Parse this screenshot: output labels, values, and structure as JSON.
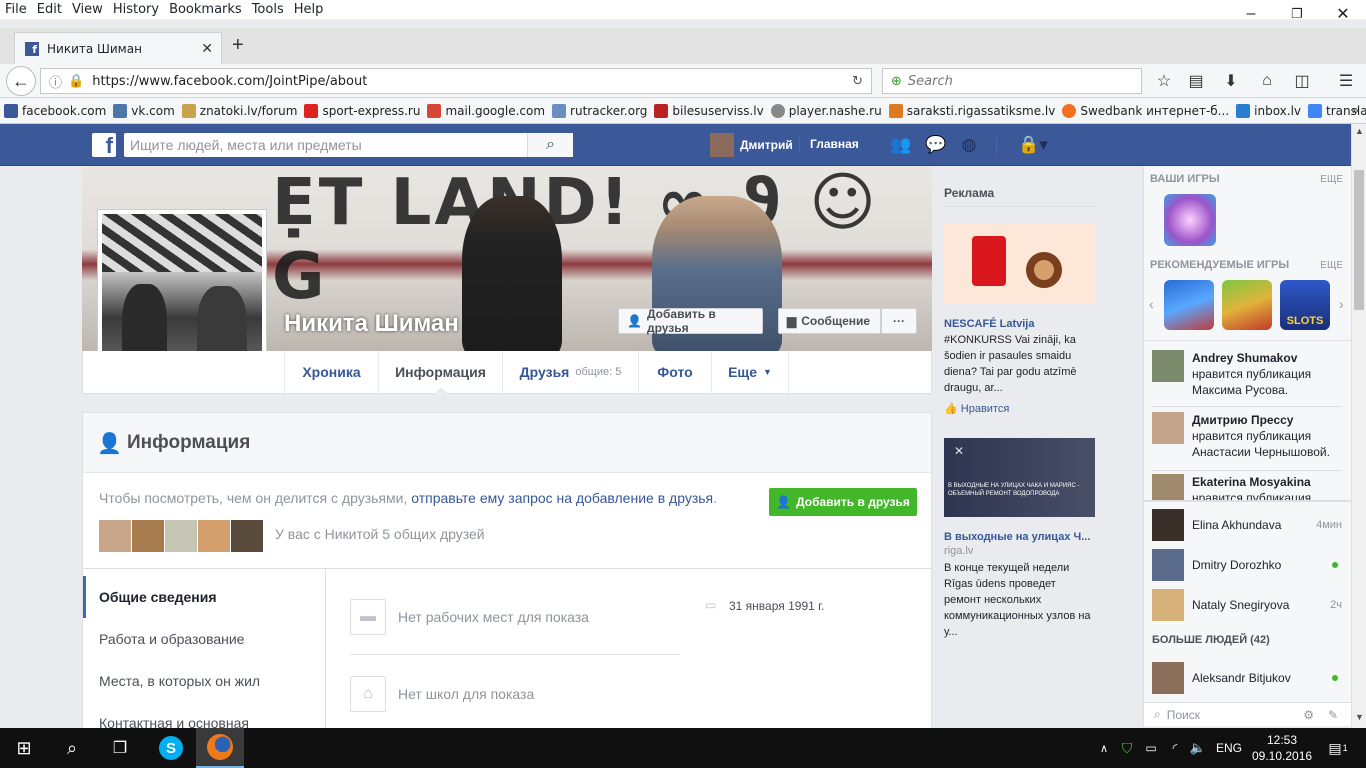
{
  "menu": [
    "File",
    "Edit",
    "View",
    "History",
    "Bookmarks",
    "Tools",
    "Help"
  ],
  "tab": {
    "title": "Никита Шиман"
  },
  "url": "https://www.facebook.com/JointPipe/about",
  "search_placeholder": "Search",
  "bookmarks": [
    "facebook.com",
    "vk.com",
    "znatoki.lv/forum",
    "sport-express.ru",
    "mail.google.com",
    "rutracker.org",
    "bilesuserviss.lv",
    "player.nashe.ru",
    "saraksti.rigassatiksme.lv",
    "Swedbank интернет-б...",
    "inbox.lv",
    "translate.google.ru"
  ],
  "fb": {
    "search_placeholder": "Ищите людей, места или предметы",
    "user": "Дмитрий",
    "home": "Главная"
  },
  "profile": {
    "name": "Никита Шиман",
    "add_friend": "Добавить в друзья",
    "message": "Сообщение",
    "more": "···",
    "tabs": {
      "timeline": "Хроника",
      "about": "Информация",
      "friends": "Друзья",
      "friends_mutual": "общие: 5",
      "photos": "Фото",
      "more": "Еще"
    }
  },
  "about": {
    "title": "Информация",
    "prompt_text": "Чтобы посмотреть, чем он делится с друзьями,",
    "prompt_link": "отправьте ему запрос на добавление в друзья",
    "prompt_end": ".",
    "add_friend": "Добавить в друзья",
    "mutual": "У вас с Никитой 5 общих друзей",
    "sections": [
      "Общие сведения",
      "Работа и образование",
      "Места, в которых он жил",
      "Контактная и основная"
    ],
    "no_work": "Нет рабочих мест для показа",
    "no_school": "Нет школ для показа",
    "birthday": "31 января 1991 г."
  },
  "ads": {
    "heading": "Реклама",
    "ad1": {
      "title": "NESCAFÉ Latvija",
      "text": "#KONKURSS Vai zināji, ka šodien ir pasaules smaidu diena? Tai par godu atzīmē draugu, ar...",
      "like": "Нравится"
    },
    "ad2": {
      "banner": "В ВЫХОДНЫЕ НА УЛИЦАХ ЧАКА И МАРИЯС - ОБЪЕМНЫЙ РЕМОНТ ВОДОПРОВОДА",
      "title": "В выходные на улицах Ч...",
      "domain": "riga.lv",
      "text": "В конце текущей недели Rīgas ūdens проведет ремонт нескольких коммуникационных узлов на у..."
    }
  },
  "right": {
    "your_games": "ВАШИ ИГРЫ",
    "recommended": "РЕКОМЕНДУЕМЫЕ ИГРЫ",
    "more": "ЕЩЕ",
    "slots": "SLOTS",
    "feed": [
      {
        "name": "Andrey Shumakov",
        "text": "нравится публикация Максима Русова."
      },
      {
        "name": "Дмитрию Прессу",
        "text": "нравится публикация Анастасии Чернышовой."
      },
      {
        "name": "Ekaterina Mosyakina",
        "text": "нравится публикация"
      }
    ],
    "chat": [
      {
        "name": "Elina Akhundava",
        "meta": "4мин"
      },
      {
        "name": "Dmitry Dorozhko",
        "meta": ""
      },
      {
        "name": "Nataly Snegiryova",
        "meta": "2ч"
      }
    ],
    "more_people": "БОЛЬШЕ ЛЮДЕЙ (42)",
    "chat2": [
      {
        "name": "Aleksandr Bitjukov"
      }
    ],
    "search": "Поиск"
  },
  "taskbar": {
    "lang": "ENG",
    "time": "12:53",
    "date": "09.10.2016",
    "notif": "1"
  }
}
